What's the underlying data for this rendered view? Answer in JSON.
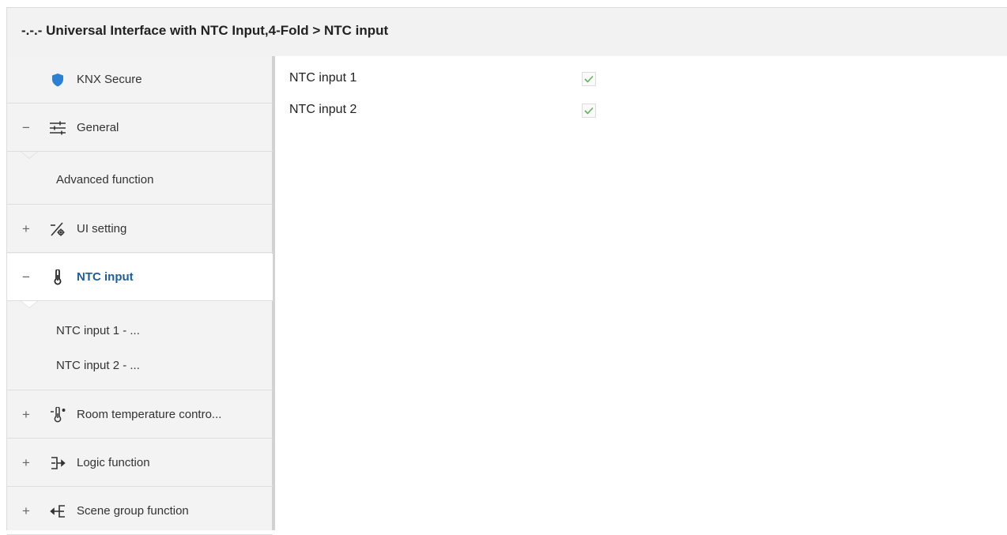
{
  "header": {
    "title": "-.-.- Universal Interface with NTC Input,4-Fold > NTC input"
  },
  "sidebar": {
    "items": [
      {
        "label": "KNX Secure",
        "expander": "",
        "icon": "shield-icon"
      },
      {
        "label": "General",
        "expander": "−",
        "icon": "sliders-icon"
      },
      {
        "label": "UI setting",
        "expander": "+",
        "icon": "ui-setting-icon"
      },
      {
        "label": "NTC input",
        "expander": "−",
        "icon": "thermometer-icon",
        "active": true
      },
      {
        "label": "Room temperature contro...",
        "expander": "+",
        "icon": "thermometer-sun-icon"
      },
      {
        "label": "Logic function",
        "expander": "+",
        "icon": "logic-icon"
      },
      {
        "label": "Scene group function",
        "expander": "+",
        "icon": "scene-group-icon"
      }
    ],
    "general_children": [
      "Advanced function"
    ],
    "ntc_children": [
      "NTC input 1 - ...",
      "NTC input 2 - ..."
    ]
  },
  "params": [
    {
      "label": "NTC input 1",
      "checked": true
    },
    {
      "label": "NTC input 2",
      "checked": true
    }
  ],
  "colors": {
    "active_text": "#1d5fa0",
    "check": "#5cb85c",
    "shield": "#2b7fd4"
  }
}
